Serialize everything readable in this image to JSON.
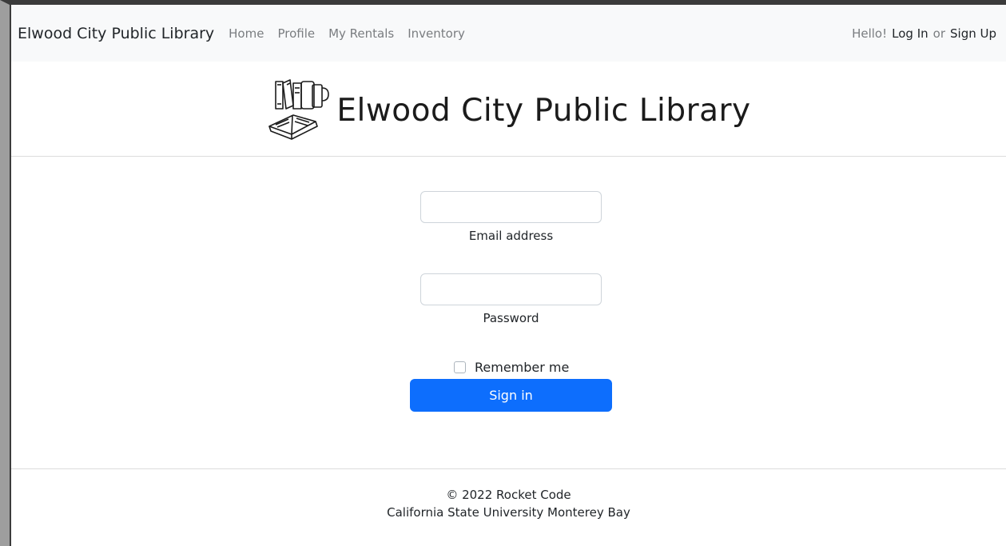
{
  "navbar": {
    "brand": "Elwood City Public Library",
    "links": [
      "Home",
      "Profile",
      "My Rentals",
      "Inventory"
    ],
    "greeting": "Hello!",
    "login": "Log In",
    "or": "or",
    "signup": "Sign Up"
  },
  "header": {
    "title": "Elwood City Public Library",
    "logo_icon": "books-icon"
  },
  "form": {
    "email_value": "",
    "email_label": "Email address",
    "password_value": "",
    "password_label": "Password",
    "remember_label": "Remember me",
    "remember_checked": false,
    "submit_label": "Sign in"
  },
  "footer": {
    "line1": "© 2022 Rocket Code",
    "line2": "California State University Monterey Bay"
  },
  "colors": {
    "primary": "#0d6efd",
    "navbar_bg": "#f8f9fa",
    "muted_link": "#7a7d80"
  }
}
